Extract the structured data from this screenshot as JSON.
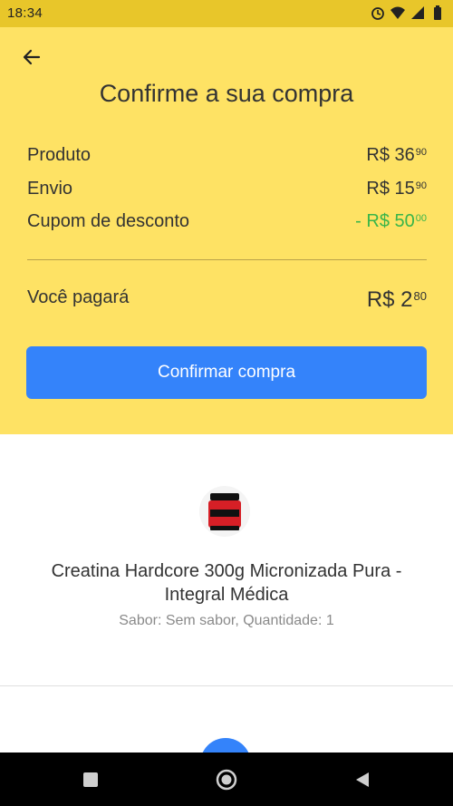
{
  "status": {
    "time": "18:34"
  },
  "header": {
    "title": "Confirme a sua compra"
  },
  "summary": {
    "rows": [
      {
        "label": "Produto",
        "value": "R$ 36",
        "cents": "90"
      },
      {
        "label": "Envio",
        "value": "R$ 15",
        "cents": "90"
      },
      {
        "label": "Cupom de desconto",
        "value": "- R$ 50",
        "cents": "00"
      }
    ],
    "total": {
      "label": "Você pagará",
      "value": "R$ 2",
      "cents": "80"
    }
  },
  "actions": {
    "confirm_label": "Confirmar compra"
  },
  "product": {
    "name": "Creatina Hardcore 300g Micronizada Pura - Integral Médica",
    "meta": "Sabor: Sem sabor, Quantidade: 1"
  },
  "colors": {
    "header_bg": "#fee264",
    "primary_button": "#3483fa",
    "discount": "#39b54a"
  },
  "icons": [
    "back-arrow-icon",
    "alarm-icon",
    "wifi-icon",
    "signal-icon",
    "battery-icon",
    "square-icon",
    "circle-icon",
    "triangle-icon"
  ]
}
